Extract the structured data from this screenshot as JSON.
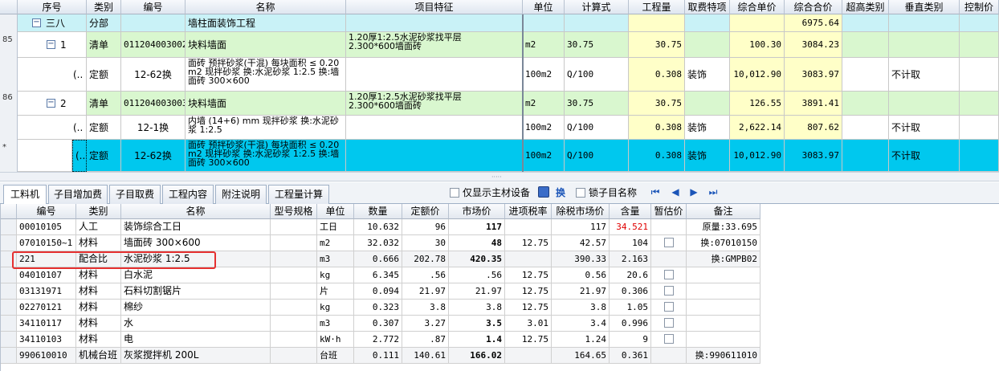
{
  "top": {
    "headers": [
      "序号",
      "类别",
      "编号",
      "名称",
      "项目特征",
      "单位",
      "计算式",
      "工程量",
      "取费特项",
      "综合单价",
      "综合合价",
      "超高类别",
      "垂直类别",
      "控制价"
    ],
    "gutter_labels": {
      "r1": "85",
      "r3": "86",
      "r6": "*"
    },
    "rows": [
      {
        "seq": "三八",
        "type": "分部",
        "code": "",
        "name": "墙柱面装饰工程",
        "feature": "",
        "unit": "",
        "formula": "",
        "qty": "",
        "fee": "",
        "uprice": "",
        "total": "6975.64",
        "super": "",
        "vert": ""
      },
      {
        "seq": "1",
        "type": "清单",
        "code": "011204003002",
        "name": "块料墙面",
        "feature": "1.20厚1:2.5水泥砂浆找平层\n2.300*600墙面砖",
        "unit": "m2",
        "formula": "30.75",
        "qty": "30.75",
        "fee": "",
        "uprice": "100.30",
        "total": "3084.23",
        "super": "",
        "vert": ""
      },
      {
        "seq": "(..",
        "type": "定额",
        "code": "12-62换",
        "name": "面砖 预拌砂浆(干混) 每块面积 ≤ 0.20m2 现拌砂浆 换:水泥砂浆 1:2.5 换:墙面砖 300×600",
        "feature": "",
        "unit": "100m2",
        "formula": "Q/100",
        "qty": "0.308",
        "fee": "装饰",
        "uprice": "10,012.90",
        "total": "3083.97",
        "super": "",
        "vert": "不计取"
      },
      {
        "seq": "2",
        "type": "清单",
        "code": "011204003003",
        "name": "块料墙面",
        "feature": "1.20厚1:2.5水泥砂浆找平层\n2.300*600墙面砖",
        "unit": "m2",
        "formula": "30.75",
        "qty": "30.75",
        "fee": "",
        "uprice": "126.55",
        "total": "3891.41",
        "super": "",
        "vert": ""
      },
      {
        "seq": "(..",
        "type": "定额",
        "code": "12-1换",
        "name": "内墙 (14+6) mm 现拌砂浆 换:水泥砂浆 1:2.5",
        "feature": "",
        "unit": "100m2",
        "formula": "Q/100",
        "qty": "0.308",
        "fee": "装饰",
        "uprice": "2,622.14",
        "total": "807.62",
        "super": "",
        "vert": "不计取"
      },
      {
        "seq": "(..",
        "type": "定额",
        "code": "12-62换",
        "name": "面砖 预拌砂浆(干混) 每块面积 ≤ 0.20m2 现拌砂浆 换:水泥砂浆 1:2.5 换:墙面砖 300×600",
        "feature": "",
        "unit": "100m2",
        "formula": "Q/100",
        "qty": "0.308",
        "fee": "装饰",
        "uprice": "10,012.90",
        "total": "3083.97",
        "super": "",
        "vert": "不计取"
      }
    ]
  },
  "tabs": [
    "工料机",
    "子目增加费",
    "子目取费",
    "工程内容",
    "附注说明",
    "工程量计算"
  ],
  "toolbar": {
    "only_main": "仅显示主材设备",
    "swap": "换",
    "lock_name": "锁子目名称"
  },
  "bottom": {
    "headers": [
      "编号",
      "类别",
      "名称",
      "型号规格",
      "单位",
      "数量",
      "定额价",
      "市场价",
      "进项税率",
      "除税市场价",
      "含量",
      "暂估价",
      "备注"
    ],
    "rows": [
      {
        "code": "00010105",
        "type": "人工",
        "name": "装饰综合工日",
        "spec": "",
        "unit": "工日",
        "qty": "10.632",
        "quota": "96",
        "market": "117",
        "tax": "",
        "net": "117",
        "content": "34.521",
        "est": false,
        "note": "原量:33.695"
      },
      {
        "code": "07010150~1",
        "type": "材料",
        "name": "墙面砖 300×600",
        "spec": "",
        "unit": "m2",
        "qty": "32.032",
        "quota": "30",
        "market": "48",
        "tax": "12.75",
        "net": "42.57",
        "content": "104",
        "est": true,
        "note": "换:07010150"
      },
      {
        "code": "221",
        "type": "配合比",
        "name": "水泥砂浆 1:2.5",
        "spec": "",
        "unit": "m3",
        "qty": "0.666",
        "quota": "202.78",
        "market": "420.35",
        "tax": "",
        "net": "390.33",
        "content": "2.163",
        "est": false,
        "note": "换:GMPB02"
      },
      {
        "code": "04010107",
        "type": "材料",
        "name": "白水泥",
        "spec": "",
        "unit": "kg",
        "qty": "6.345",
        "quota": ".56",
        "market": ".56",
        "tax": "12.75",
        "net": "0.56",
        "content": "20.6",
        "est": true,
        "note": ""
      },
      {
        "code": "03131971",
        "type": "材料",
        "name": "石料切割锯片",
        "spec": "",
        "unit": "片",
        "qty": "0.094",
        "quota": "21.97",
        "market": "21.97",
        "tax": "12.75",
        "net": "21.97",
        "content": "0.306",
        "est": true,
        "note": ""
      },
      {
        "code": "02270121",
        "type": "材料",
        "name": "棉纱",
        "spec": "",
        "unit": "kg",
        "qty": "0.323",
        "quota": "3.8",
        "market": "3.8",
        "tax": "12.75",
        "net": "3.8",
        "content": "1.05",
        "est": true,
        "note": ""
      },
      {
        "code": "34110117",
        "type": "材料",
        "name": "水",
        "spec": "",
        "unit": "m3",
        "qty": "0.307",
        "quota": "3.27",
        "market": "3.5",
        "tax": "3.01",
        "net": "3.4",
        "content": "0.996",
        "est": true,
        "note": ""
      },
      {
        "code": "34110103",
        "type": "材料",
        "name": "电",
        "spec": "",
        "unit": "kW·h",
        "qty": "2.772",
        "quota": ".87",
        "market": "1.4",
        "tax": "12.75",
        "net": "1.24",
        "content": "9",
        "est": true,
        "note": ""
      },
      {
        "code": "990610010",
        "type": "机械台班",
        "name": "灰浆搅拌机 200L",
        "spec": "",
        "unit": "台班",
        "qty": "0.111",
        "quota": "140.61",
        "market": "166.02",
        "tax": "",
        "net": "164.65",
        "content": "0.361",
        "est": false,
        "note": "换:990611010"
      }
    ]
  },
  "colors": {
    "division": "#c9f2f7",
    "bill": "#d9f7cf",
    "quota": "#ffffff",
    "selected": "#00c8ee",
    "yellow": "#ffffc8",
    "highlight_box": "#e53030",
    "red_text": "#e00000"
  }
}
